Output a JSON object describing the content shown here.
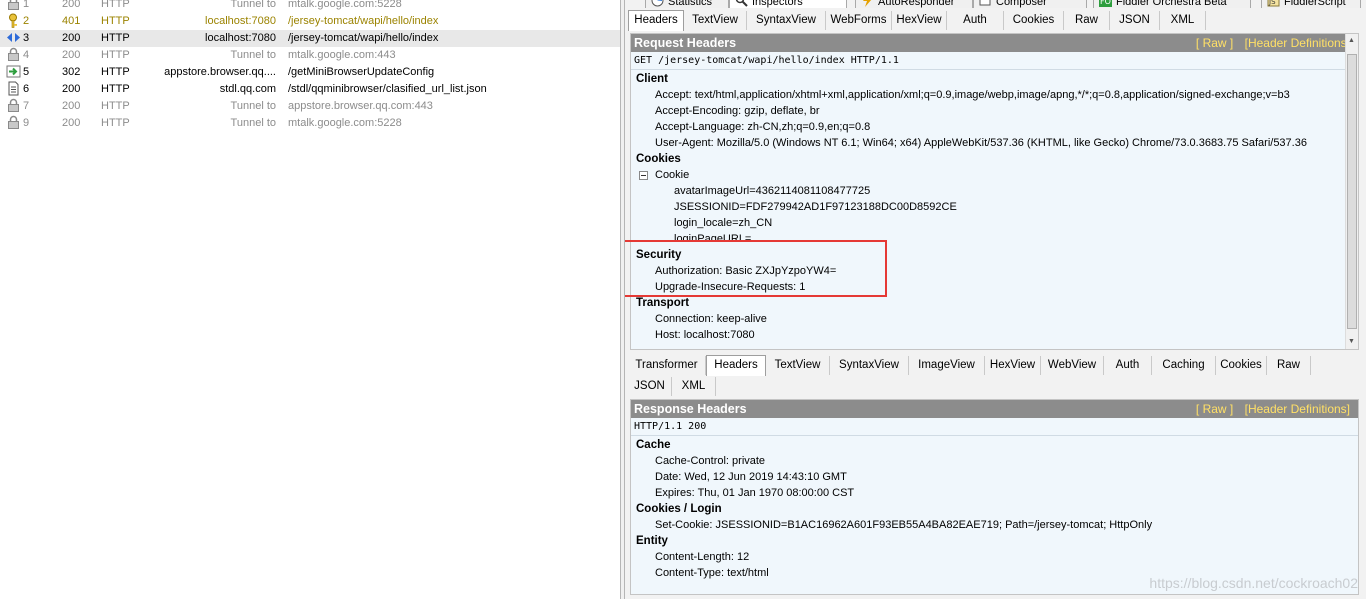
{
  "sessions": [
    {
      "num": "1",
      "result": "200",
      "protocol": "HTTP",
      "host": "Tunnel to",
      "url": "mtalk.google.com:5228",
      "icon": "lock-icon",
      "style": "gray"
    },
    {
      "num": "2",
      "result": "401",
      "protocol": "HTTP",
      "host": "localhost:7080",
      "url": "/jersey-tomcat/wapi/hello/index",
      "icon": "key-icon",
      "style": "olive"
    },
    {
      "num": "3",
      "result": "200",
      "protocol": "HTTP",
      "host": "localhost:7080",
      "url": "/jersey-tomcat/wapi/hello/index",
      "icon": "request-arrows-icon",
      "style": "black",
      "selected": true
    },
    {
      "num": "4",
      "result": "200",
      "protocol": "HTTP",
      "host": "Tunnel to",
      "url": "mtalk.google.com:443",
      "icon": "lock-icon",
      "style": "gray"
    },
    {
      "num": "5",
      "result": "302",
      "protocol": "HTTP",
      "host": "appstore.browser.qq....",
      "url": "/getMiniBrowserUpdateConfig",
      "icon": "redirect-arrow-icon",
      "style": "black"
    },
    {
      "num": "6",
      "result": "200",
      "protocol": "HTTP",
      "host": "stdl.qq.com",
      "url": "/stdl/qqminibrowser/clasified_url_list.json",
      "icon": "document-icon",
      "style": "black"
    },
    {
      "num": "7",
      "result": "200",
      "protocol": "HTTP",
      "host": "Tunnel to",
      "url": "appstore.browser.qq.com:443",
      "icon": "lock-icon",
      "style": "gray"
    },
    {
      "num": "9",
      "result": "200",
      "protocol": "HTTP",
      "host": "Tunnel to",
      "url": "mtalk.google.com:5228",
      "icon": "lock-icon",
      "style": "gray"
    }
  ],
  "top_tabs": {
    "statistics": "Statistics",
    "inspectors": "Inspectors",
    "autoresponder": "AutoResponder",
    "composer": "Composer",
    "orchestra": "Fiddler Orchestra Beta",
    "fiddlerscript": "FiddlerScript"
  },
  "request_tabs": [
    "Headers",
    "TextView",
    "SyntaxView",
    "WebForms",
    "HexView",
    "Auth",
    "Cookies",
    "Raw",
    "JSON",
    "XML"
  ],
  "request": {
    "title": "Request Headers",
    "raw_link": "[ Raw ]",
    "defs_link": "[Header Definitions]",
    "request_line": "GET /jersey-tomcat/wapi/hello/index HTTP/1.1",
    "client_group": "Client",
    "accept": "Accept: text/html,application/xhtml+xml,application/xml;q=0.9,image/webp,image/apng,*/*;q=0.8,application/signed-exchange;v=b3",
    "accept_encoding": "Accept-Encoding: gzip, deflate, br",
    "accept_language": "Accept-Language: zh-CN,zh;q=0.9,en;q=0.8",
    "user_agent": "User-Agent: Mozilla/5.0 (Windows NT 6.1; Win64; x64) AppleWebKit/537.36 (KHTML, like Gecko) Chrome/73.0.3683.75 Safari/537.36",
    "cookies_group": "Cookies",
    "cookie_node": "Cookie",
    "cookie_avatar": "avatarImageUrl=4362114081108477725",
    "cookie_session": "JSESSIONID=FDF279942AD1F97123188DC00D8592CE",
    "cookie_locale": "login_locale=zh_CN",
    "cookie_loginpage": "loginPageURL=",
    "security_group": "Security",
    "authorization": "Authorization: Basic ZXJpYzpoYW4=",
    "upgrade_insecure": "Upgrade-Insecure-Requests: 1",
    "transport_group": "Transport",
    "connection": "Connection: keep-alive",
    "host": "Host: localhost:7080"
  },
  "response_tabs_row1": [
    "Transformer",
    "Headers",
    "TextView",
    "SyntaxView",
    "ImageView",
    "HexView",
    "WebView",
    "Auth",
    "Caching",
    "Cookies",
    "Raw"
  ],
  "response_tabs_row2": [
    "JSON",
    "XML"
  ],
  "response": {
    "title": "Response Headers",
    "raw_link": "[ Raw ]",
    "defs_link": "[Header Definitions]",
    "status_line": "HTTP/1.1 200",
    "cache_group": "Cache",
    "cache_control": "Cache-Control: private",
    "date": "Date: Wed, 12 Jun 2019 14:43:10 GMT",
    "expires": "Expires: Thu, 01 Jan 1970 08:00:00 CST",
    "cookies_group": "Cookies / Login",
    "set_cookie": "Set-Cookie: JSESSIONID=B1AC16962A601F93EB55A4BA82EAE719; Path=/jersey-tomcat; HttpOnly",
    "entity_group": "Entity",
    "content_length": "Content-Length: 12",
    "content_type": "Content-Type: text/html"
  },
  "watermark": "https://blog.csdn.net/cockroach02",
  "colors": {
    "highlight": "#e53935",
    "header_bar": "#8c8c8c",
    "header_link": "#ffe066",
    "panel_bg": "#f0f7fc"
  }
}
